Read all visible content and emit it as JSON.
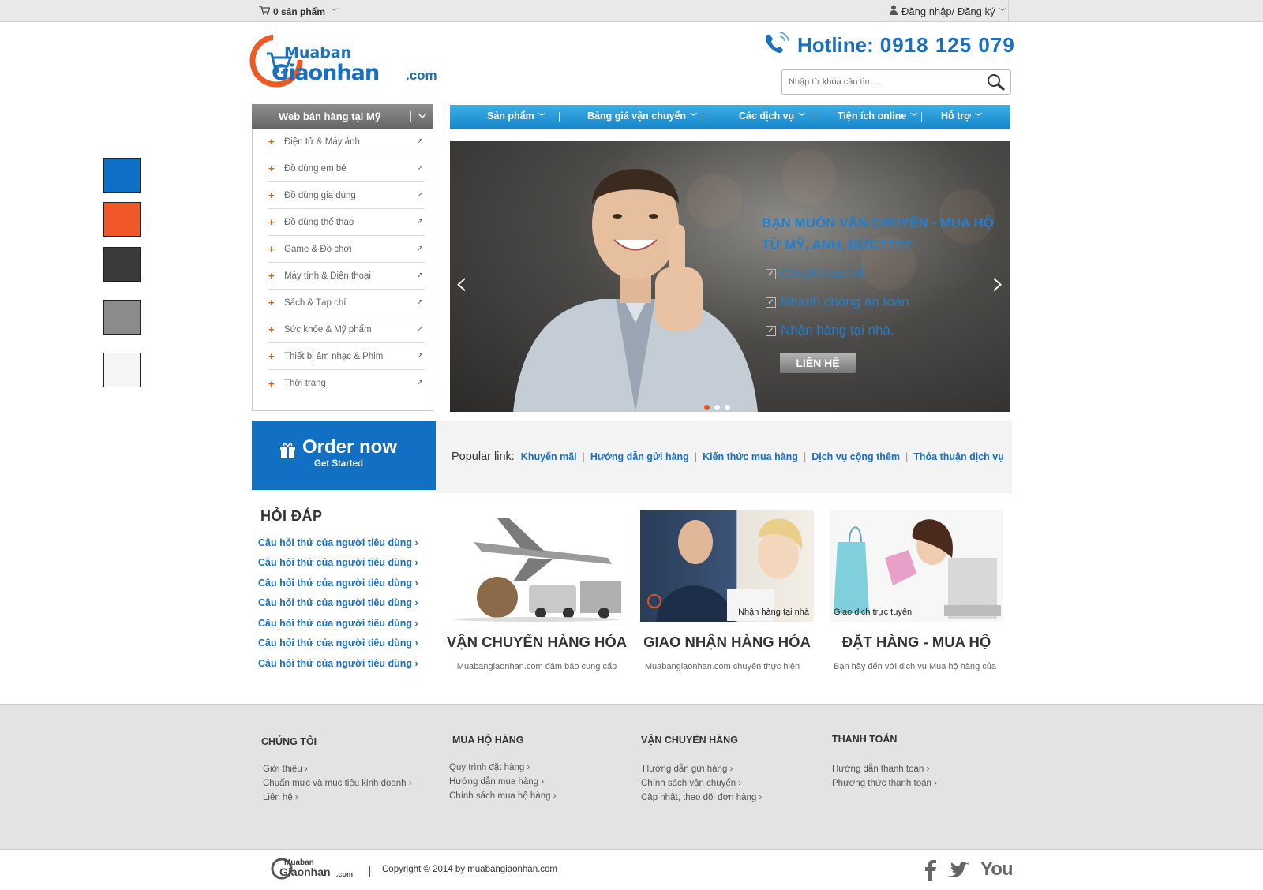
{
  "topbar": {
    "cart_label": "0 sản phẩm",
    "login_label": "Đăng nhập/ Đăng ký"
  },
  "header": {
    "logo_top": "Muaban",
    "logo_bottom": "Giaonhan",
    "logo_domain": ".com",
    "hotline_label": "Hotline:",
    "hotline_number": "0918 125 079",
    "search_placeholder": "Nhập từ khóa cần tìm..."
  },
  "sidebar": {
    "title": "Web bán hàng tại Mỹ",
    "items": [
      {
        "label": "Điện tử & Máy ảnh"
      },
      {
        "label": "Đồ dùng em bé"
      },
      {
        "label": "Đồ dùng gia dụng"
      },
      {
        "label": "Đồ dùng thể thao"
      },
      {
        "label": "Game & Đồ chơi"
      },
      {
        "label": "Máy tính & Điện thoại"
      },
      {
        "label": "Sách & Tạp chí"
      },
      {
        "label": "Sức khỏe & Mỹ phẩm"
      },
      {
        "label": "Thiết bị âm nhạc & Phim"
      },
      {
        "label": "Thời trang"
      }
    ]
  },
  "nav": {
    "items": [
      {
        "label": "Sản phẩm"
      },
      {
        "label": "Bảng giá vận chuyển"
      },
      {
        "label": "Các dịch vụ"
      },
      {
        "label": "Tiện ích online"
      },
      {
        "label": "Hỗ trợ"
      }
    ]
  },
  "slider": {
    "headline": "BẠN MUỐN VẬN CHUYỂN - MUA HỘ TỪ MỸ, ANH, ĐỨC????",
    "bullets": [
      "Chi phí cực rẻ",
      "Nhanh chóng an toàn",
      "Nhận hàng tại nhà."
    ],
    "button": "LIÊN HỆ",
    "active_dot": 1,
    "dot_count": 3
  },
  "order": {
    "title": "Order now",
    "subtitle": "Get Started"
  },
  "popular": {
    "label": "Popular link:",
    "links": [
      "Khuyến mãi",
      "Hướng dẫn gửi hàng",
      "Kiến thức mua hàng",
      "Dịch vụ cộng thêm",
      "Thỏa thuận dịch vụ"
    ]
  },
  "faq": {
    "title": "HỎI ĐÁP",
    "items": [
      "Câu hỏi thứ của người tiêu dùng ›",
      "Câu hỏi thứ của người tiêu dùng ›",
      "Câu hỏi thứ của người tiêu dùng ›",
      "Câu hỏi thứ của người tiêu dùng ›",
      "Câu hỏi thứ của người tiêu dùng ›",
      "Câu hỏi thứ của người tiêu dùng ›",
      "Câu hỏi thứ của người tiêu dùng ›"
    ]
  },
  "services": [
    {
      "title": "VẬN CHUYỂN HÀNG HÓA",
      "desc": "Muabangiaonhan.com đảm bảo cung cấp",
      "caption": ""
    },
    {
      "title": "GIAO NHẬN HÀNG HÓA",
      "desc": "Muabangiaonhan.com chuyên thực hiện",
      "caption": "Nhận hàng tại nhà"
    },
    {
      "title": "ĐẶT HÀNG - MUA HỘ",
      "desc": "Bạn hãy đến với dịch vụ Mua hộ hàng của",
      "caption": "Giao dịch trực tuyến"
    }
  ],
  "footer": {
    "columns": [
      {
        "title": "CHÚNG TÔI",
        "links": [
          "Giới thiệu ›",
          "Chuẩn mực và mục tiêu kinh doanh ›",
          "Liên hệ ›"
        ]
      },
      {
        "title": "MUA HỘ HÀNG",
        "links": [
          "Quy trình đặt hàng ›",
          "Hướng dẫn mua hàng ›",
          "Chính sách mua hộ hàng ›"
        ]
      },
      {
        "title": "VẬN CHUYỂN HÀNG",
        "links": [
          "Hướng dẫn gửi hàng ›",
          "Chính sách vận chuyển ›",
          "Cập nhật, theo dõi đơn hàng ›"
        ]
      },
      {
        "title": "THANH TOÁN",
        "links": [
          "Hướng dẫn thanh toán ›",
          "Phương thức thanh toán ›"
        ]
      }
    ],
    "copyright": "Copyright © 2014 by muabangiaonhan.com",
    "social": [
      "facebook-icon",
      "twitter-icon",
      "youtube-icon"
    ],
    "youtube_label": "You"
  },
  "swatches": [
    "#0d6fc6",
    "#f0582a",
    "#3a3a3a",
    "#8c8c8c",
    "#f5f5f5"
  ]
}
